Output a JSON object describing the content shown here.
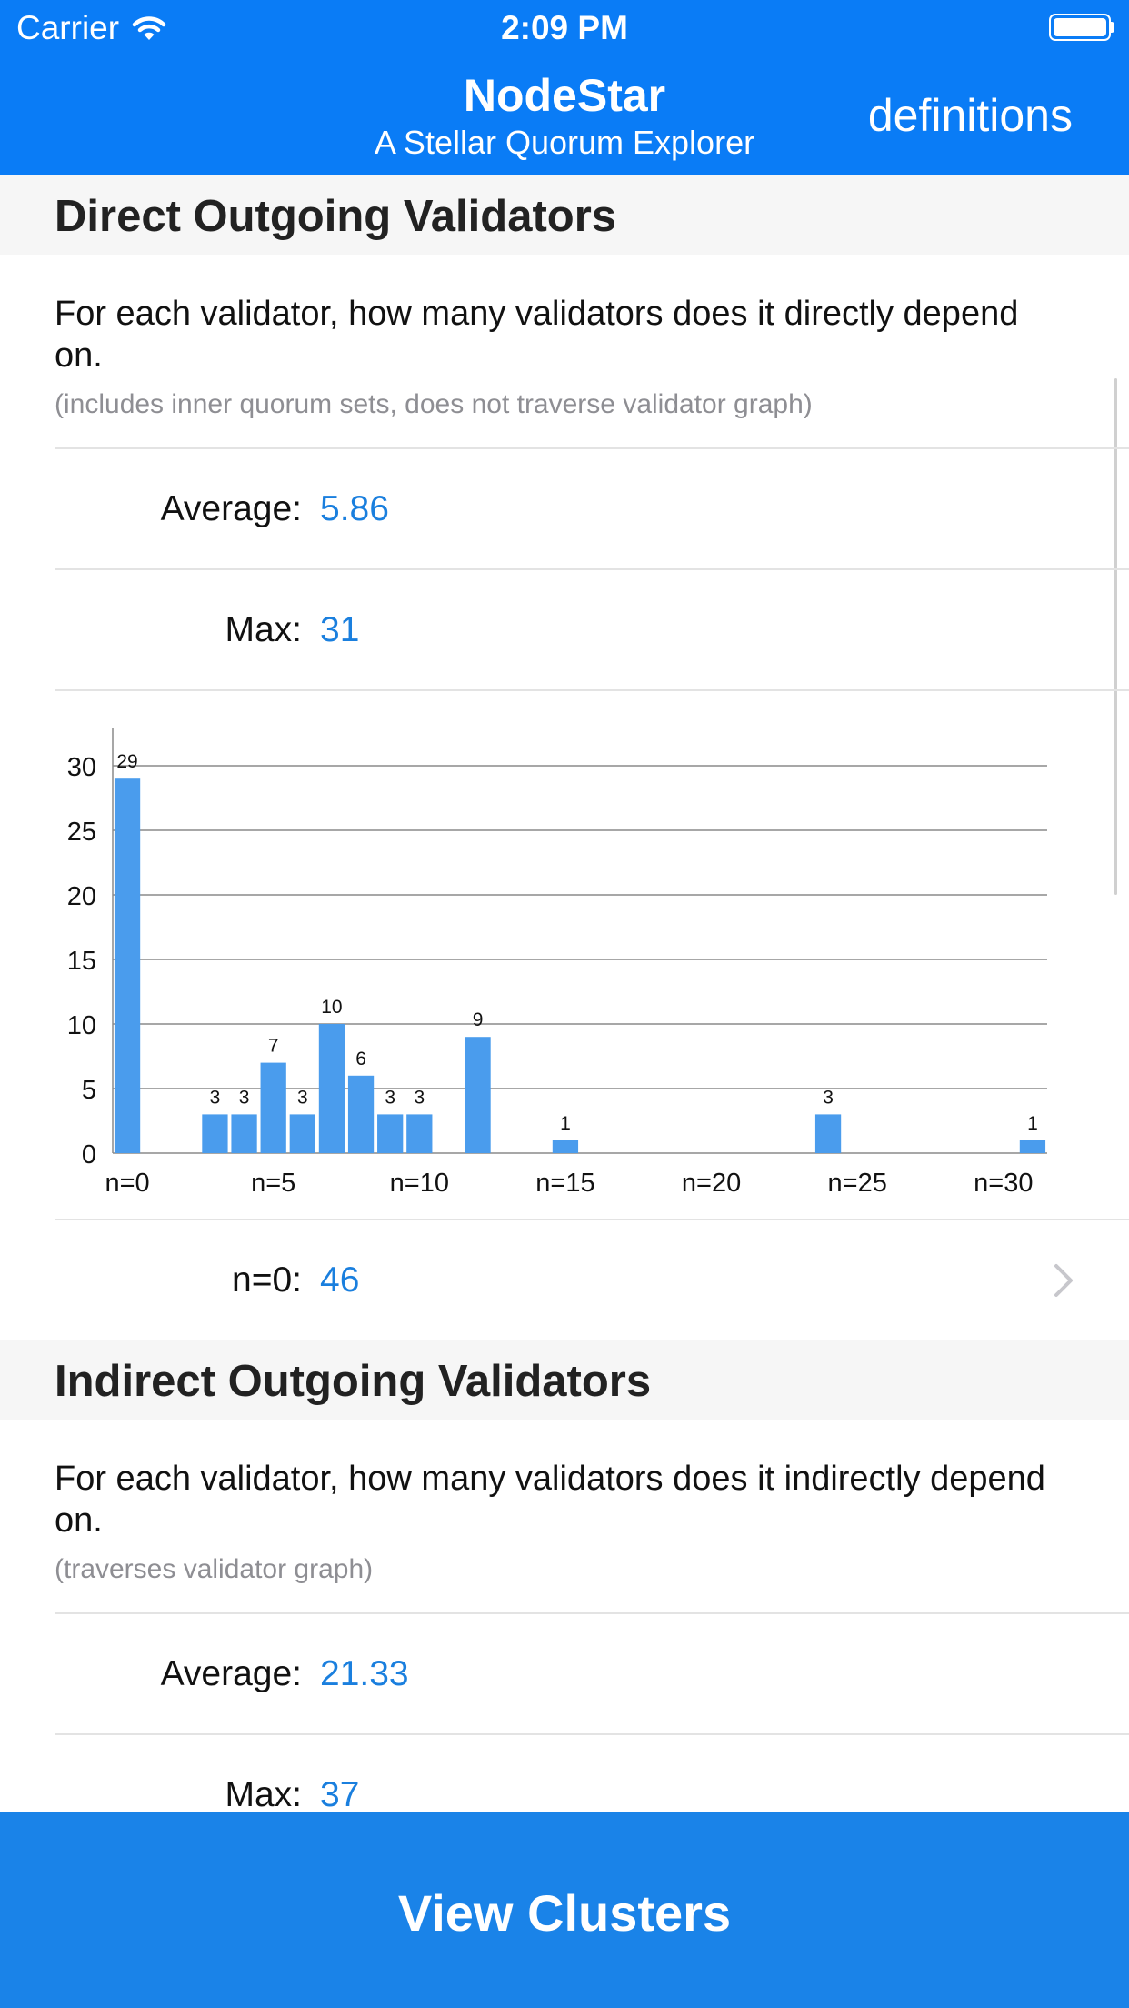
{
  "status_bar": {
    "carrier": "Carrier",
    "time": "2:09 PM"
  },
  "nav": {
    "title": "NodeStar",
    "subtitle": "A Stellar Quorum Explorer",
    "action": "definitions"
  },
  "direct": {
    "header": "Direct Outgoing Validators",
    "description": "For each validator, how many validators does it directly depend on.",
    "note": "(includes inner quorum sets, does not traverse validator graph)",
    "average_label": "Average:",
    "average_value": "5.86",
    "max_label": "Max:",
    "max_value": "31",
    "selected_label": "n=0:",
    "selected_value": "46"
  },
  "indirect": {
    "header": "Indirect Outgoing Validators",
    "description": "For each validator, how many validators does it indirectly depend on.",
    "note": "(traverses validator graph)",
    "average_label": "Average:",
    "average_value": "21.33",
    "max_label": "Max:",
    "max_value": "37"
  },
  "bottom_button": {
    "label": "View Clusters"
  },
  "colors": {
    "nav_bg": "#0a7cf6",
    "accent_value": "#1a7fde",
    "bar": "#4a9ced",
    "button_bg": "#1a83e8"
  },
  "chart_data": {
    "type": "bar",
    "x": [
      0,
      3,
      4,
      5,
      6,
      7,
      8,
      9,
      10,
      12,
      15,
      24,
      31
    ],
    "values": [
      29,
      3,
      3,
      7,
      3,
      10,
      6,
      3,
      3,
      9,
      1,
      3,
      1
    ],
    "xlim": [
      0,
      31
    ],
    "ylim": [
      0,
      31
    ],
    "yticks": [
      0,
      5,
      10,
      15,
      20,
      25,
      30
    ],
    "xticks": [
      0,
      5,
      10,
      15,
      20,
      25,
      30
    ],
    "xtick_labels": [
      "n=0",
      "n=5",
      "n=10",
      "n=15",
      "n=20",
      "n=25",
      "n=30"
    ],
    "grid": true,
    "data_labels": true
  }
}
